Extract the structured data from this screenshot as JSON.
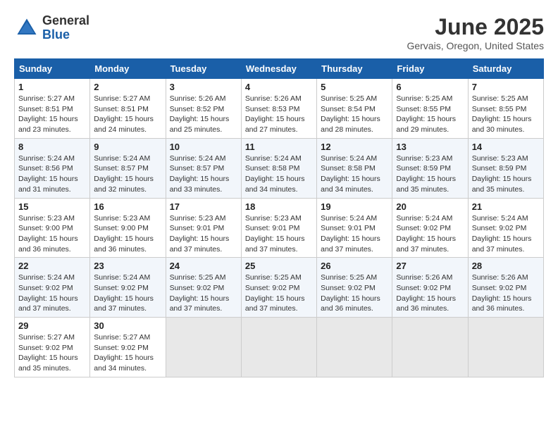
{
  "logo": {
    "general": "General",
    "blue": "Blue"
  },
  "title": "June 2025",
  "location": "Gervais, Oregon, United States",
  "days_of_week": [
    "Sunday",
    "Monday",
    "Tuesday",
    "Wednesday",
    "Thursday",
    "Friday",
    "Saturday"
  ],
  "weeks": [
    [
      {
        "day": "1",
        "sunrise": "Sunrise: 5:27 AM",
        "sunset": "Sunset: 8:51 PM",
        "daylight": "Daylight: 15 hours and 23 minutes."
      },
      {
        "day": "2",
        "sunrise": "Sunrise: 5:27 AM",
        "sunset": "Sunset: 8:51 PM",
        "daylight": "Daylight: 15 hours and 24 minutes."
      },
      {
        "day": "3",
        "sunrise": "Sunrise: 5:26 AM",
        "sunset": "Sunset: 8:52 PM",
        "daylight": "Daylight: 15 hours and 25 minutes."
      },
      {
        "day": "4",
        "sunrise": "Sunrise: 5:26 AM",
        "sunset": "Sunset: 8:53 PM",
        "daylight": "Daylight: 15 hours and 27 minutes."
      },
      {
        "day": "5",
        "sunrise": "Sunrise: 5:25 AM",
        "sunset": "Sunset: 8:54 PM",
        "daylight": "Daylight: 15 hours and 28 minutes."
      },
      {
        "day": "6",
        "sunrise": "Sunrise: 5:25 AM",
        "sunset": "Sunset: 8:55 PM",
        "daylight": "Daylight: 15 hours and 29 minutes."
      },
      {
        "day": "7",
        "sunrise": "Sunrise: 5:25 AM",
        "sunset": "Sunset: 8:55 PM",
        "daylight": "Daylight: 15 hours and 30 minutes."
      }
    ],
    [
      {
        "day": "8",
        "sunrise": "Sunrise: 5:24 AM",
        "sunset": "Sunset: 8:56 PM",
        "daylight": "Daylight: 15 hours and 31 minutes."
      },
      {
        "day": "9",
        "sunrise": "Sunrise: 5:24 AM",
        "sunset": "Sunset: 8:57 PM",
        "daylight": "Daylight: 15 hours and 32 minutes."
      },
      {
        "day": "10",
        "sunrise": "Sunrise: 5:24 AM",
        "sunset": "Sunset: 8:57 PM",
        "daylight": "Daylight: 15 hours and 33 minutes."
      },
      {
        "day": "11",
        "sunrise": "Sunrise: 5:24 AM",
        "sunset": "Sunset: 8:58 PM",
        "daylight": "Daylight: 15 hours and 34 minutes."
      },
      {
        "day": "12",
        "sunrise": "Sunrise: 5:24 AM",
        "sunset": "Sunset: 8:58 PM",
        "daylight": "Daylight: 15 hours and 34 minutes."
      },
      {
        "day": "13",
        "sunrise": "Sunrise: 5:23 AM",
        "sunset": "Sunset: 8:59 PM",
        "daylight": "Daylight: 15 hours and 35 minutes."
      },
      {
        "day": "14",
        "sunrise": "Sunrise: 5:23 AM",
        "sunset": "Sunset: 8:59 PM",
        "daylight": "Daylight: 15 hours and 35 minutes."
      }
    ],
    [
      {
        "day": "15",
        "sunrise": "Sunrise: 5:23 AM",
        "sunset": "Sunset: 9:00 PM",
        "daylight": "Daylight: 15 hours and 36 minutes."
      },
      {
        "day": "16",
        "sunrise": "Sunrise: 5:23 AM",
        "sunset": "Sunset: 9:00 PM",
        "daylight": "Daylight: 15 hours and 36 minutes."
      },
      {
        "day": "17",
        "sunrise": "Sunrise: 5:23 AM",
        "sunset": "Sunset: 9:01 PM",
        "daylight": "Daylight: 15 hours and 37 minutes."
      },
      {
        "day": "18",
        "sunrise": "Sunrise: 5:23 AM",
        "sunset": "Sunset: 9:01 PM",
        "daylight": "Daylight: 15 hours and 37 minutes."
      },
      {
        "day": "19",
        "sunrise": "Sunrise: 5:24 AM",
        "sunset": "Sunset: 9:01 PM",
        "daylight": "Daylight: 15 hours and 37 minutes."
      },
      {
        "day": "20",
        "sunrise": "Sunrise: 5:24 AM",
        "sunset": "Sunset: 9:02 PM",
        "daylight": "Daylight: 15 hours and 37 minutes."
      },
      {
        "day": "21",
        "sunrise": "Sunrise: 5:24 AM",
        "sunset": "Sunset: 9:02 PM",
        "daylight": "Daylight: 15 hours and 37 minutes."
      }
    ],
    [
      {
        "day": "22",
        "sunrise": "Sunrise: 5:24 AM",
        "sunset": "Sunset: 9:02 PM",
        "daylight": "Daylight: 15 hours and 37 minutes."
      },
      {
        "day": "23",
        "sunrise": "Sunrise: 5:24 AM",
        "sunset": "Sunset: 9:02 PM",
        "daylight": "Daylight: 15 hours and 37 minutes."
      },
      {
        "day": "24",
        "sunrise": "Sunrise: 5:25 AM",
        "sunset": "Sunset: 9:02 PM",
        "daylight": "Daylight: 15 hours and 37 minutes."
      },
      {
        "day": "25",
        "sunrise": "Sunrise: 5:25 AM",
        "sunset": "Sunset: 9:02 PM",
        "daylight": "Daylight: 15 hours and 37 minutes."
      },
      {
        "day": "26",
        "sunrise": "Sunrise: 5:25 AM",
        "sunset": "Sunset: 9:02 PM",
        "daylight": "Daylight: 15 hours and 36 minutes."
      },
      {
        "day": "27",
        "sunrise": "Sunrise: 5:26 AM",
        "sunset": "Sunset: 9:02 PM",
        "daylight": "Daylight: 15 hours and 36 minutes."
      },
      {
        "day": "28",
        "sunrise": "Sunrise: 5:26 AM",
        "sunset": "Sunset: 9:02 PM",
        "daylight": "Daylight: 15 hours and 36 minutes."
      }
    ],
    [
      {
        "day": "29",
        "sunrise": "Sunrise: 5:27 AM",
        "sunset": "Sunset: 9:02 PM",
        "daylight": "Daylight: 15 hours and 35 minutes."
      },
      {
        "day": "30",
        "sunrise": "Sunrise: 5:27 AM",
        "sunset": "Sunset: 9:02 PM",
        "daylight": "Daylight: 15 hours and 34 minutes."
      },
      null,
      null,
      null,
      null,
      null
    ]
  ]
}
